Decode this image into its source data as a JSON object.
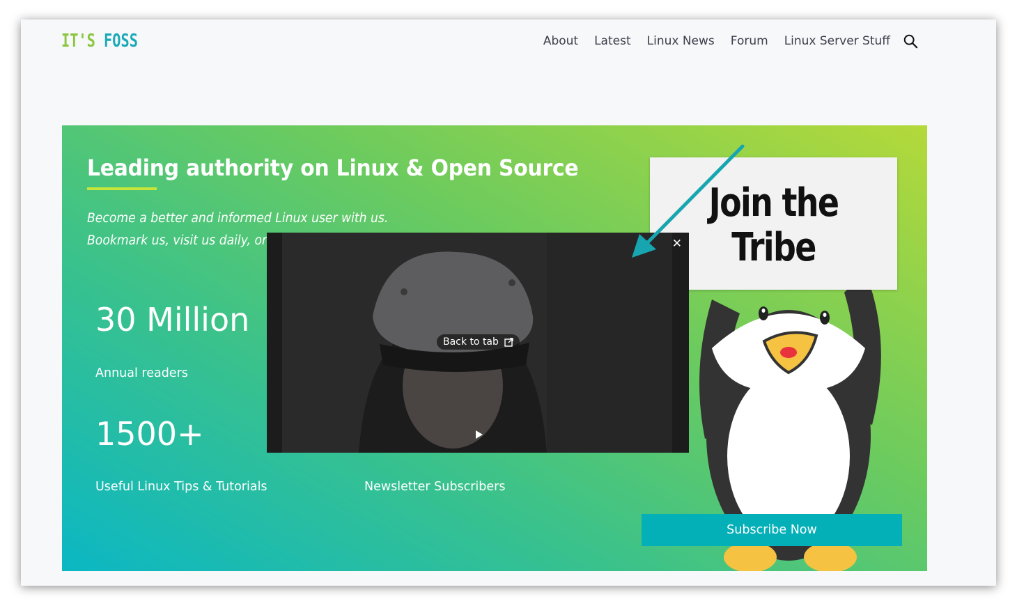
{
  "brand": {
    "logo_part1": "IT'S",
    "logo_part2": "FOSS"
  },
  "nav": {
    "items": [
      "About",
      "Latest",
      "Linux News",
      "Forum",
      "Linux Server Stuff"
    ],
    "search_icon": "search-icon"
  },
  "hero": {
    "title": "Leading authority on Linux & Open Source",
    "subtitle_line1": "Become a better and informed Linux user with us.",
    "subtitle_line2": "Bookmark us, visit us daily, or",
    "stats": [
      {
        "value": "30 Million",
        "label": "Annual readers"
      },
      {
        "value": "1500+",
        "label": "Useful Linux Tips & Tutorials"
      },
      {
        "value": "",
        "label": "Newsletter Subscribers"
      }
    ],
    "sign_line1": "Join the",
    "sign_line2": "Tribe",
    "subscribe_label": "Subscribe Now"
  },
  "pip": {
    "back_to_tab": "Back to tab",
    "close_glyph": "✕",
    "play_icon": "play-icon"
  },
  "colors": {
    "logo_green": "#8cc63f",
    "logo_teal": "#1aa9b8",
    "button": "#03b0b8",
    "annotation_arrow": "#17a6b0"
  }
}
